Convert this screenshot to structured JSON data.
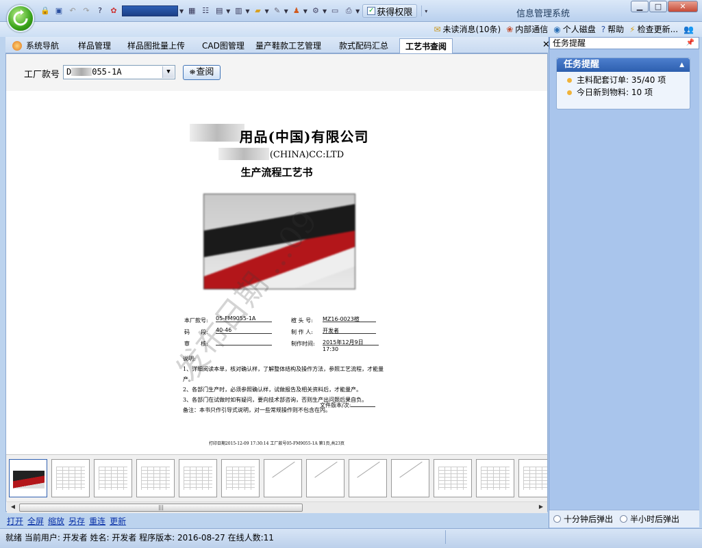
{
  "window": {
    "title": "信息管理系统"
  },
  "toolbar": {
    "permission_label": "获得权限"
  },
  "header_links": [
    {
      "label": "未读消息(10条)",
      "icon": "mail-icon"
    },
    {
      "label": "内部通信",
      "icon": "chat-icon"
    },
    {
      "label": "个人磁盘",
      "icon": "disk-icon"
    },
    {
      "label": "帮助",
      "icon": "help-icon"
    },
    {
      "label": "检查更新...",
      "icon": "update-icon"
    }
  ],
  "tabs": [
    {
      "label": "系统导航"
    },
    {
      "label": "样品管理"
    },
    {
      "label": "样品图批量上传"
    },
    {
      "label": "CAD图管理"
    },
    {
      "label": "量产鞋款工艺管理"
    },
    {
      "label": "款式配码汇总"
    },
    {
      "label": "工艺书查阅",
      "active": true
    }
  ],
  "search": {
    "label": "工厂款号",
    "value_prefix": "D",
    "value_suffix": "055-1A",
    "button_label": "查阅"
  },
  "document": {
    "company_cn_suffix": "用品(中国)有限公司",
    "company_en_suffix": "(CHINA)CC:LTD",
    "doc_title": "生产流程工艺书",
    "fields": {
      "factory_no_label": "本厂款号:",
      "factory_no_value": "05-FM9055-1A",
      "last_label": "楦 头 号:",
      "last_value": "MZ16-0023楦",
      "size_label": "码　　段:",
      "size_value": "40-46",
      "maker_label": "制 作 人:",
      "maker_value": "开发者",
      "review_label": "审　　核:",
      "time_label": "制作时间:",
      "time_value": "2015年12月9日 17:30"
    },
    "notes_title": "说明:",
    "notes": [
      "1、详细阅读本单，核对确认样，了解整体结构及操作方法，参照工艺流程，才能量产。",
      "2、各部门生产时，必须参照确认样，试做报告及相关资料后，才能量产。",
      "3、各部门在试做时如有疑问，要向技术部咨询，否则生产出问题后果自负。",
      "备注：本书只作引导式说明，对一些常规操作则不包含在内。"
    ],
    "version_label": "文件版本/次:",
    "print_footer": "打印日期2015-12-09 17:30:14 工厂款号05-FM9055-1A 第1页,共23页",
    "watermark": "发布日期 ...09"
  },
  "actions": [
    "打开",
    "全屏",
    "缩放",
    "另存",
    "重连",
    "更新"
  ],
  "status": {
    "text": "就绪 当前用户: 开发者 姓名: 开发者 程序版本: 2016-08-27 在线人数:11"
  },
  "right_panel": {
    "title": "任务提醒",
    "box_title": "任务提醒",
    "items": [
      "主料配套订单: 35/40 项",
      "今日新到物料: 10 项"
    ],
    "footer_options": [
      "十分钟后弹出",
      "半小时后弹出"
    ]
  }
}
